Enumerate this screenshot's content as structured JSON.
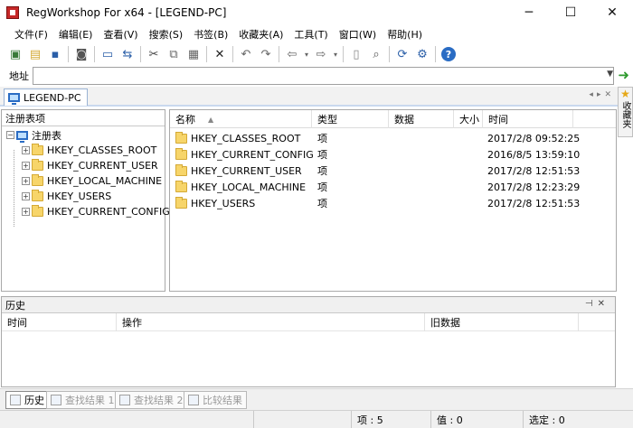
{
  "window": {
    "title": "RegWorkshop For x64 - [LEGEND-PC]",
    "buttons": {
      "minimize": "─",
      "maximize": "☐",
      "close": "✕"
    }
  },
  "menu": [
    "文件(F)",
    "编辑(E)",
    "查看(V)",
    "搜索(S)",
    "书签(B)",
    "收藏夹(A)",
    "工具(T)",
    "窗口(W)",
    "帮助(H)"
  ],
  "address": {
    "label": "地址",
    "value": ""
  },
  "doc_tab": {
    "label": "LEGEND-PC"
  },
  "sidebar_favorites": {
    "label": "收藏夹"
  },
  "tree": {
    "header": "注册表项",
    "root": "注册表",
    "children": [
      "HKEY_CLASSES_ROOT",
      "HKEY_CURRENT_USER",
      "HKEY_LOCAL_MACHINE",
      "HKEY_USERS",
      "HKEY_CURRENT_CONFIG"
    ]
  },
  "list": {
    "columns": [
      "名称",
      "类型",
      "数据",
      "大小",
      "时间"
    ],
    "rows": [
      {
        "name": "HKEY_CLASSES_ROOT",
        "type": "项",
        "data": "",
        "size": "",
        "time": "2017/2/8 09:52:25"
      },
      {
        "name": "HKEY_CURRENT_CONFIG",
        "type": "项",
        "data": "",
        "size": "",
        "time": "2016/8/5 13:59:10"
      },
      {
        "name": "HKEY_CURRENT_USER",
        "type": "项",
        "data": "",
        "size": "",
        "time": "2017/2/8 12:51:53"
      },
      {
        "name": "HKEY_LOCAL_MACHINE",
        "type": "项",
        "data": "",
        "size": "",
        "time": "2017/2/8 12:23:29"
      },
      {
        "name": "HKEY_USERS",
        "type": "项",
        "data": "",
        "size": "",
        "time": "2017/2/8 12:51:53"
      }
    ]
  },
  "history": {
    "title": "历史",
    "columns": [
      "时间",
      "操作",
      "旧数据"
    ]
  },
  "bottom_tabs": [
    "历史",
    "查找结果 1",
    "查找结果 2",
    "比较结果"
  ],
  "status": {
    "items": "项 : 5",
    "values": "值 : 0",
    "selected": "选定 : 0"
  },
  "colors": {
    "accent": "#2a6cc4",
    "folder": "#f7d56a",
    "go_arrow": "#2e9a2e"
  }
}
